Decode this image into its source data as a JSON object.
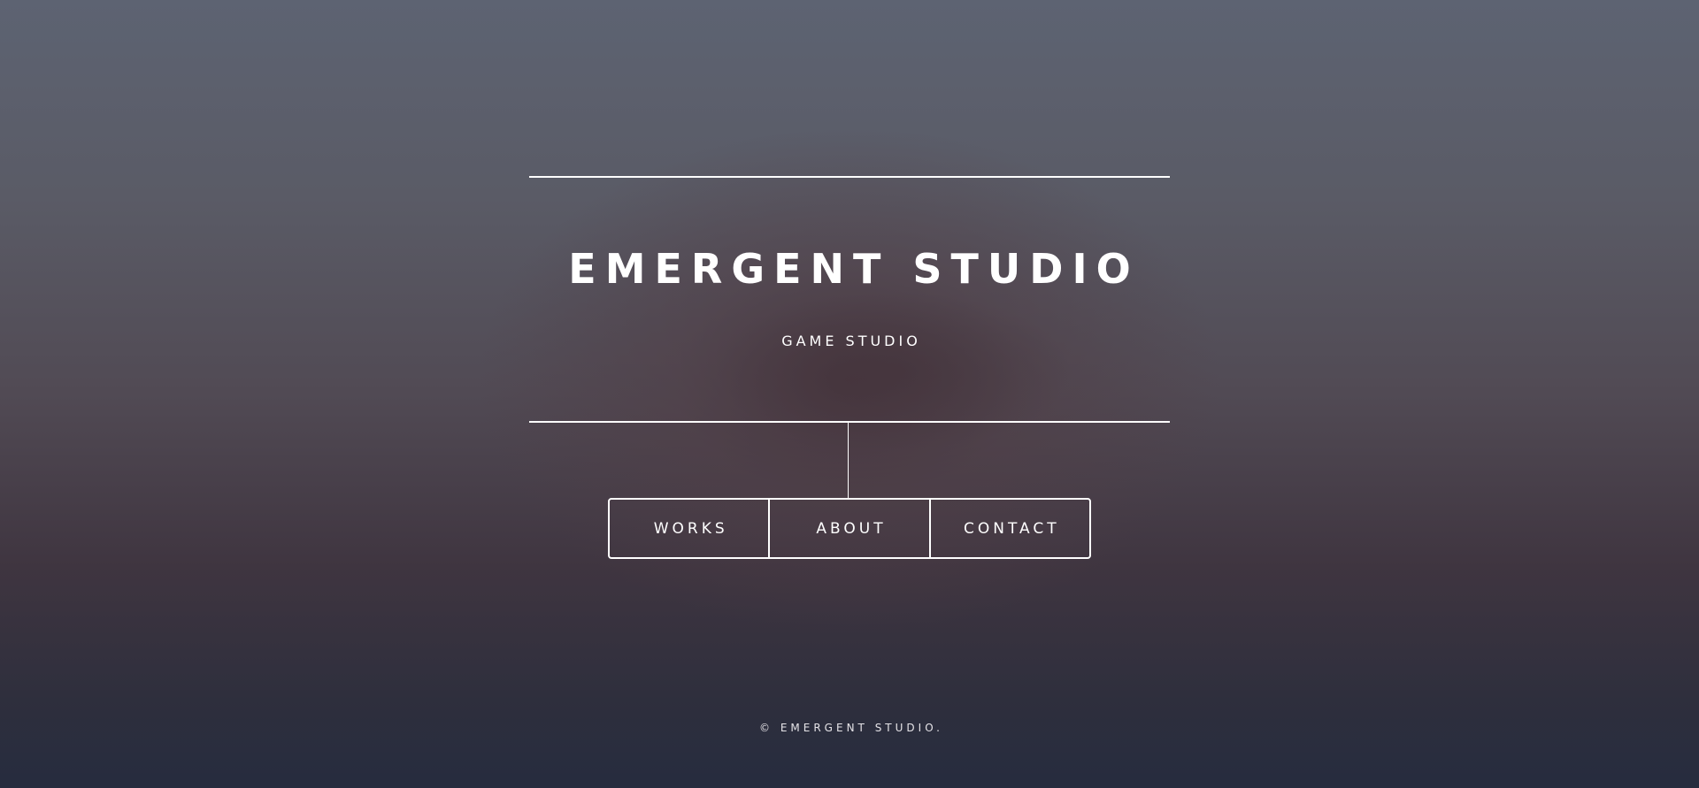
{
  "header": {
    "title": "EMERGENT STUDIO",
    "subtitle": "GAME STUDIO"
  },
  "nav": {
    "items": [
      {
        "label": "WORKS"
      },
      {
        "label": "ABOUT"
      },
      {
        "label": "CONTACT"
      }
    ]
  },
  "footer": {
    "copyright": "© EMERGENT STUDIO."
  },
  "colors": {
    "text": "#ffffff",
    "background_top": "#5d6372",
    "background_bottom": "#262c3e"
  }
}
